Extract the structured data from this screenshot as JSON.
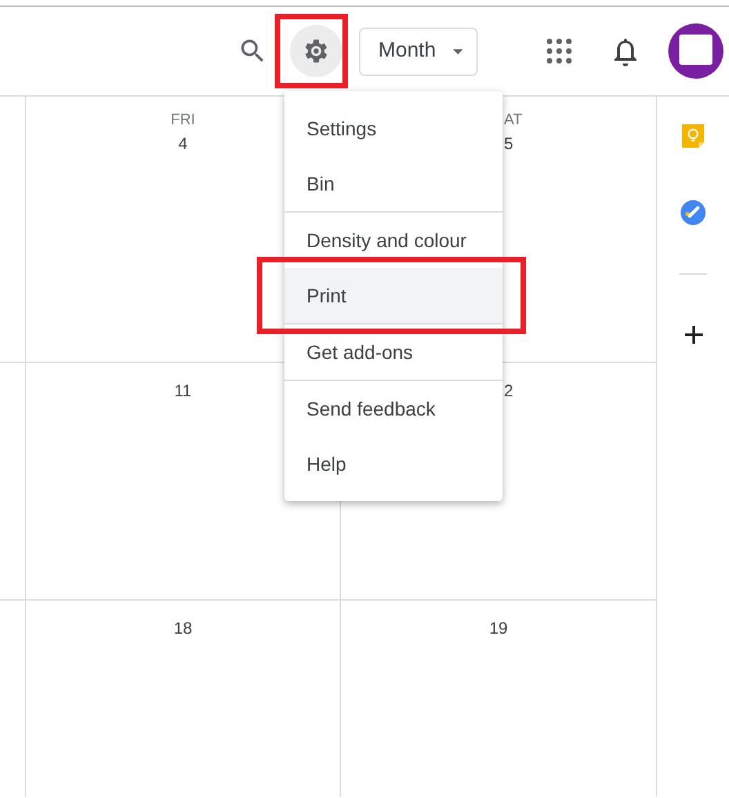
{
  "header": {
    "settings_button": {
      "active": true,
      "highlighted": true
    },
    "view_button": {
      "label": "Month"
    }
  },
  "weeks": [
    {
      "cells": [
        {
          "weekday": "FRI",
          "date": "4"
        },
        {
          "weekday": "AT",
          "date": "5"
        }
      ]
    },
    {
      "cells": [
        {
          "date": "11"
        },
        {
          "date": "2"
        }
      ]
    },
    {
      "cells": [
        {
          "date": "18"
        },
        {
          "date": "19"
        }
      ]
    }
  ],
  "settings_menu": {
    "groups": [
      {
        "items": [
          {
            "label": "Settings",
            "selected": false,
            "highlighted": false
          },
          {
            "label": "Bin",
            "selected": false,
            "highlighted": false
          }
        ]
      },
      {
        "items": [
          {
            "label": "Density and colour",
            "selected": false,
            "highlighted": false
          },
          {
            "label": "Print",
            "selected": true,
            "highlighted": true
          }
        ]
      },
      {
        "items": [
          {
            "label": "Get add-ons",
            "selected": false,
            "highlighted": false
          }
        ]
      },
      {
        "items": [
          {
            "label": "Send feedback",
            "selected": false,
            "highlighted": false
          },
          {
            "label": "Help",
            "selected": false,
            "highlighted": false
          }
        ]
      }
    ]
  }
}
